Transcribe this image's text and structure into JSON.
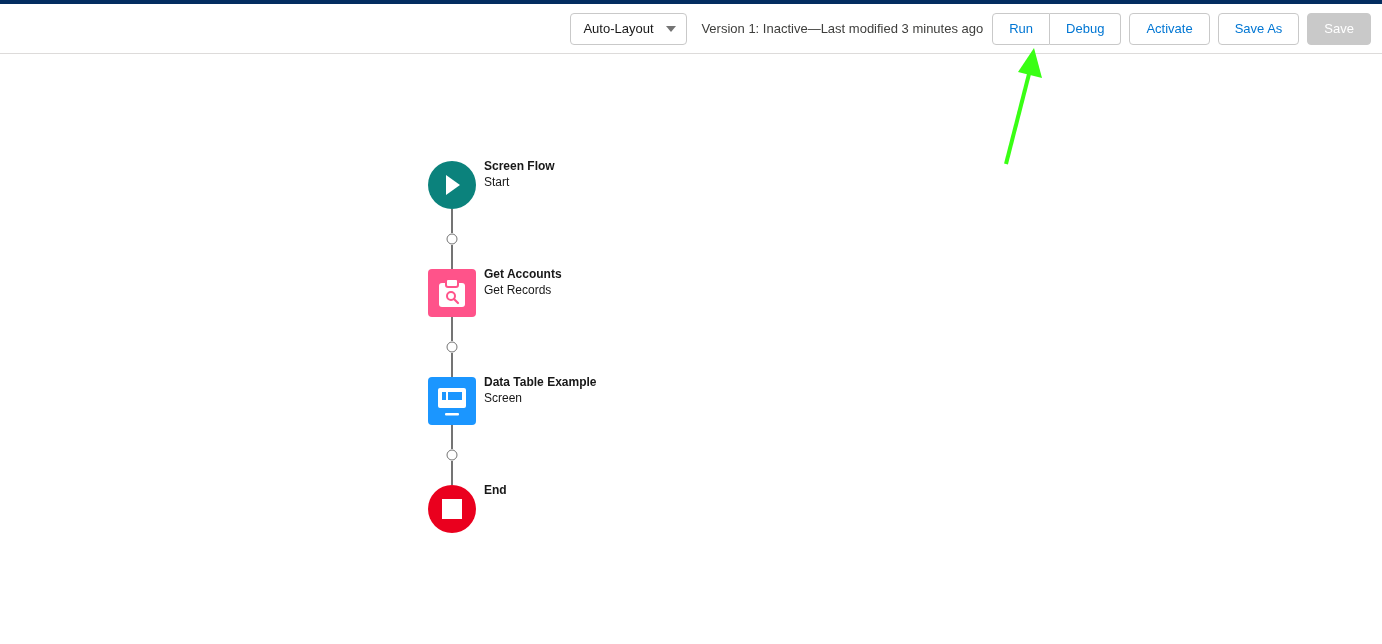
{
  "toolbar": {
    "layout_select": {
      "value": "Auto-Layout"
    },
    "status": "Version 1: Inactive—Last modified 3 minutes ago",
    "button_group": [
      {
        "label": "Run",
        "disabled": false
      },
      {
        "label": "Debug",
        "disabled": false
      }
    ],
    "buttons": [
      {
        "label": "Activate",
        "disabled": false
      },
      {
        "label": "Save As",
        "disabled": false
      },
      {
        "label": "Save",
        "disabled": true
      }
    ]
  },
  "flow": {
    "nodes": [
      {
        "kind": "start",
        "title": "Screen Flow",
        "subtitle": "Start"
      },
      {
        "kind": "get-records",
        "title": "Get Accounts",
        "subtitle": "Get Records"
      },
      {
        "kind": "screen",
        "title": "Data Table Example",
        "subtitle": "Screen"
      },
      {
        "kind": "end",
        "title": "End"
      }
    ]
  }
}
